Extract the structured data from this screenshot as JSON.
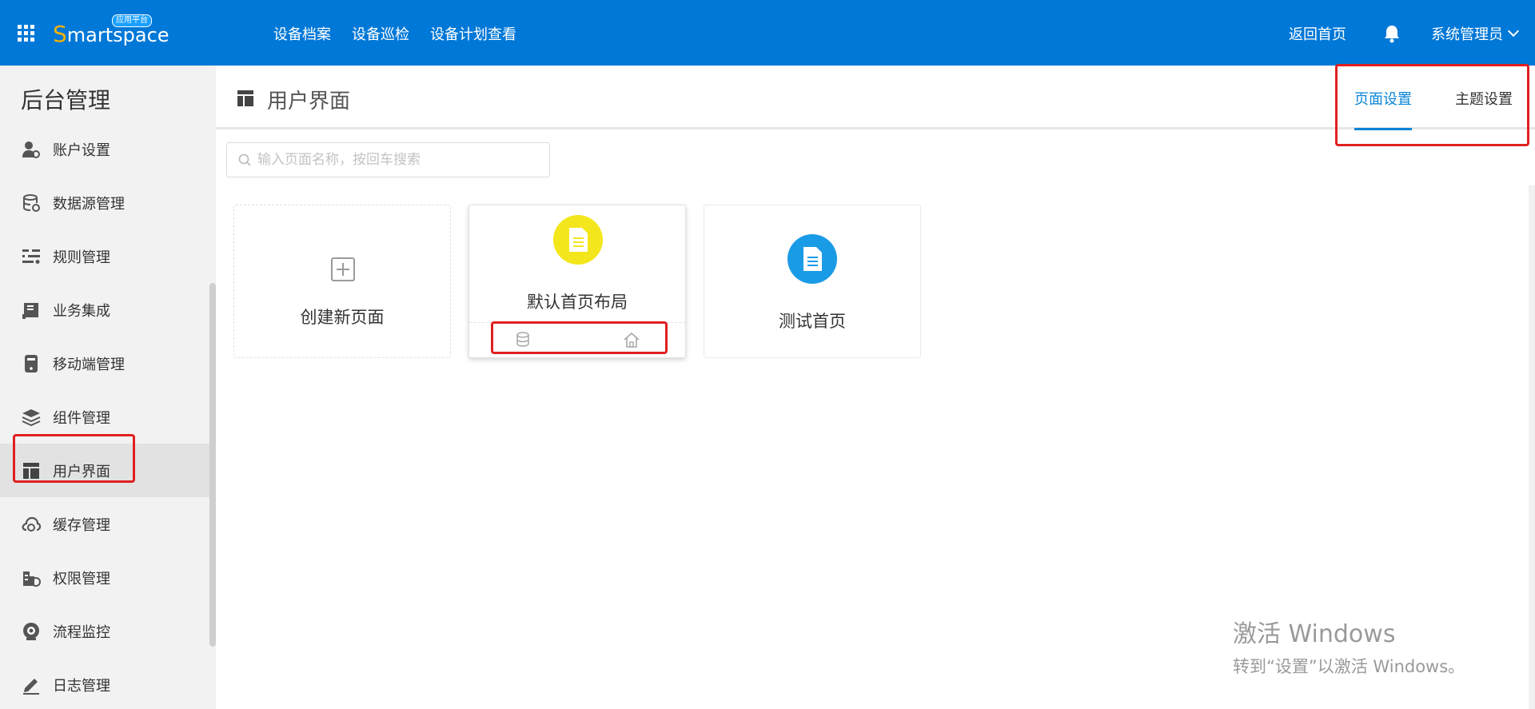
{
  "topbar": {
    "logo_prefix": "S",
    "logo_rest": "martspace",
    "logo_badge": "应用平台",
    "nav": [
      "设备档案",
      "设备巡检",
      "设备计划查看"
    ],
    "home_link": "返回首页",
    "user": "系统管理员"
  },
  "sidebar": {
    "title": "后台管理",
    "items": [
      {
        "label": "账户设置",
        "icon": "account-settings-icon"
      },
      {
        "label": "数据源管理",
        "icon": "database-icon"
      },
      {
        "label": "规则管理",
        "icon": "sliders-icon"
      },
      {
        "label": "业务集成",
        "icon": "book-icon"
      },
      {
        "label": "移动端管理",
        "icon": "mobile-icon"
      },
      {
        "label": "组件管理",
        "icon": "layers-icon"
      },
      {
        "label": "用户界面",
        "icon": "layout-icon",
        "active": true
      },
      {
        "label": "缓存管理",
        "icon": "cloud-icon"
      },
      {
        "label": "权限管理",
        "icon": "permission-icon"
      },
      {
        "label": "流程监控",
        "icon": "camera-icon"
      },
      {
        "label": "日志管理",
        "icon": "pen-icon"
      }
    ]
  },
  "main": {
    "title": "用户界面",
    "tabs": [
      {
        "label": "页面设置",
        "active": true
      },
      {
        "label": "主题设置",
        "active": false
      }
    ],
    "search": {
      "placeholder": "输入页面名称，按回车搜索",
      "value": ""
    },
    "cards": [
      {
        "label": "创建新页面"
      },
      {
        "label": "默认首页布局",
        "color": "#f4e61c"
      },
      {
        "label": "测试首页",
        "color": "#1a9be6"
      }
    ]
  },
  "watermark": {
    "line1": "激活 Windows",
    "line2": "转到“设置”以激活 Windows。"
  },
  "colors": {
    "topbar": "#0078d7",
    "accent": "#0a84d6",
    "highlight": "#e02020"
  }
}
